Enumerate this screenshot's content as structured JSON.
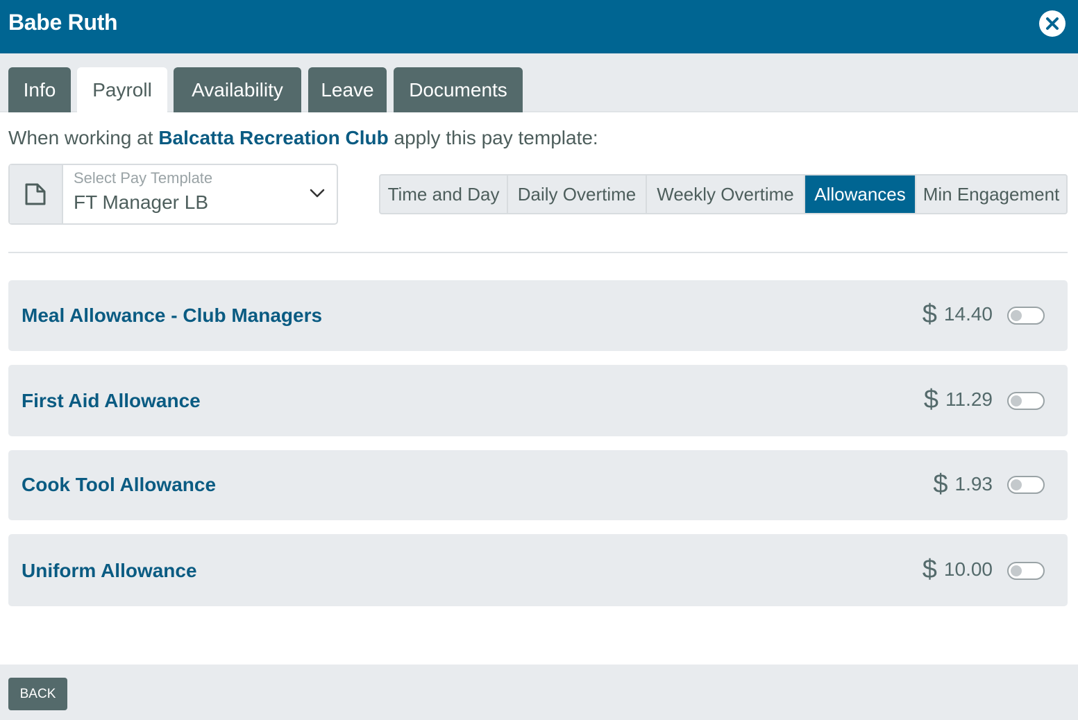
{
  "header": {
    "title": "Babe Ruth",
    "close_icon": "close-icon"
  },
  "tabs": [
    {
      "label": "Info",
      "active": false
    },
    {
      "label": "Payroll",
      "active": true
    },
    {
      "label": "Availability",
      "active": false
    },
    {
      "label": "Leave",
      "active": false
    },
    {
      "label": "Documents",
      "active": false
    }
  ],
  "intro": {
    "prefix": "When working at",
    "club": "Balcatta Recreation Club",
    "suffix": "apply this pay template:"
  },
  "pay_template": {
    "label": "Select Pay Template",
    "value": "FT Manager LB",
    "icon": "document-icon"
  },
  "segments": [
    {
      "label": "Time and Day",
      "active": false
    },
    {
      "label": "Daily Overtime",
      "active": false
    },
    {
      "label": "Weekly Overtime",
      "active": false
    },
    {
      "label": "Allowances",
      "active": true
    },
    {
      "label": "Min Engagement",
      "active": false
    }
  ],
  "allowances": [
    {
      "name": "Meal Allowance - Club Managers",
      "currency": "$",
      "amount": "14.40",
      "enabled": false
    },
    {
      "name": "First Aid Allowance",
      "currency": "$",
      "amount": "11.29",
      "enabled": false
    },
    {
      "name": "Cook Tool Allowance",
      "currency": "$",
      "amount": "1.93",
      "enabled": false
    },
    {
      "name": "Uniform Allowance",
      "currency": "$",
      "amount": "10.00",
      "enabled": false
    }
  ],
  "footer": {
    "back_label": "BACK"
  },
  "colors": {
    "brand": "#006592",
    "tab_inactive": "#546a6b",
    "link": "#0a5b82",
    "panel": "#e8ebee"
  }
}
